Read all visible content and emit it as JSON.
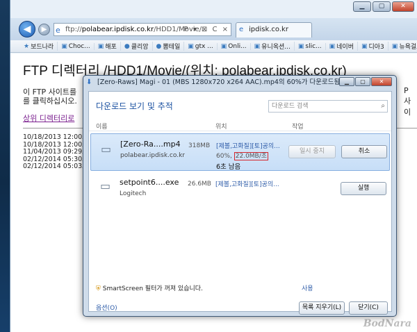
{
  "browser": {
    "address_prefix": "ftp://",
    "address_host": "polabear.ipdisk.co.kr",
    "address_path": "/HDD1/Movie/",
    "address_tools": "P ▾ ⊠ C ×",
    "tab_title": "ipdisk.co.kr",
    "window_buttons": [
      "▁",
      "▢",
      "✕"
    ],
    "favorites": [
      {
        "icon": "★",
        "label": "보드나라"
      },
      {
        "icon": "▣",
        "label": "Choc..."
      },
      {
        "icon": "▣",
        "label": "해포"
      },
      {
        "icon": "●",
        "label": "클리앙"
      },
      {
        "icon": "●",
        "label": "뽐테일"
      },
      {
        "icon": "▣",
        "label": "gtx ..."
      },
      {
        "icon": "▣",
        "label": "Onli..."
      },
      {
        "icon": "▣",
        "label": "유니옥션..."
      },
      {
        "icon": "▣",
        "label": "slic..."
      },
      {
        "icon": "▣",
        "label": "네이버"
      },
      {
        "icon": "▣",
        "label": "디아3"
      },
      {
        "icon": "▣",
        "label": "뉴욕걸즈"
      }
    ]
  },
  "page": {
    "title": "FTP 디렉터리 /HDD1/Movie/(위치: polabear.ipdisk.co.kr)",
    "desc_line1": "이 FTP 사이트를",
    "desc_line2": "를 클릭하십시오.",
    "desc_right": "P 사이",
    "parent_link": "상위 디렉터리로",
    "listing": [
      "10/18/2013 12:00오",
      "10/18/2013 12:00오",
      "11/04/2013 09:29오",
      "02/12/2014 05:30오",
      "02/12/2014 05:03오"
    ],
    "watermark": "BodNara"
  },
  "dialog": {
    "title": "[Zero-Raws] Magi - 01 (MBS 1280x720 x264 AAC).mp4의 60%가 다운로드됨",
    "heading": "다운로드 보기 및 추적",
    "search_placeholder": "다운로드 검색",
    "col_name": "이름",
    "col_location": "위치",
    "col_action": "작업",
    "downloads": [
      {
        "name": "[Zero-Ra....mp4",
        "publisher": "polabear.ipdisk.co.kr",
        "size": "318MB",
        "location": "[제볼,고화질][토]공의...",
        "progress_pct": "60%,",
        "speed": "22.0MB/초",
        "remaining": "6초 남음",
        "pause_label": "일시 중지",
        "cancel_label": "취소"
      },
      {
        "name": "setpoint6....exe",
        "publisher": "Logitech",
        "size": "26.6MB",
        "location": "[제볼,고화질][토]공의...",
        "run_label": "실행"
      }
    ],
    "smartscreen_text": "SmartScreen 필터가 꺼져 있습니다.",
    "enable_label": "사용",
    "options_label": "옵션(O)",
    "clear_list_label": "목록 지우기(L)",
    "close_label": "닫기(C)",
    "window_buttons": [
      "▁",
      "▢",
      "✕"
    ]
  }
}
